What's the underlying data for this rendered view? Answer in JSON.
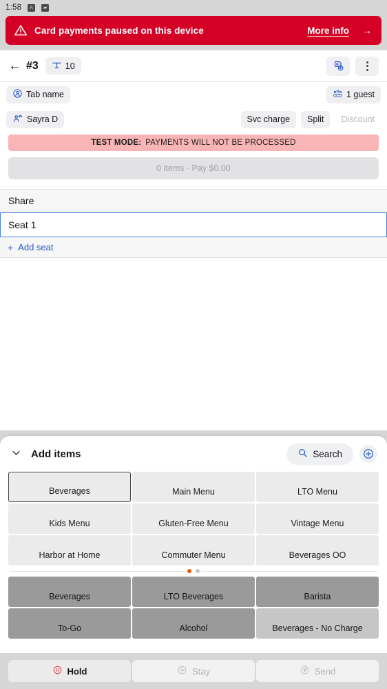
{
  "status_bar": {
    "time": "1:58",
    "icons": [
      "app-icon",
      "image-icon"
    ]
  },
  "alert": {
    "icon": "warning-triangle-icon",
    "message": "Card payments paused on this device",
    "link_label": "More info",
    "arrow": "→",
    "color": "#d50026"
  },
  "order_header": {
    "back": "←",
    "order_number": "#3",
    "table_icon": "table-icon",
    "table_number": "10",
    "refund_icon": "receipt-refund-icon",
    "more_icon": "kebab-menu-icon"
  },
  "info_row": {
    "tab_name_icon": "person-circle-icon",
    "tab_name": "Tab name",
    "guests_icon": "guests-group-icon",
    "guests": "1 guest"
  },
  "server_row": {
    "server_icon": "server-person-icon",
    "server_name": "Sayra D",
    "actions": [
      {
        "label": "Svc charge",
        "disabled": false
      },
      {
        "label": "Split",
        "disabled": false
      },
      {
        "label": "Discount",
        "disabled": true
      }
    ]
  },
  "test_mode": {
    "prefix": "TEST MODE:",
    "message": "PAYMENTS WILL NOT BE PROCESSED",
    "color": "#f9b5b5"
  },
  "pay_bar": {
    "label": "0 items · Pay $0.00",
    "disabled": true
  },
  "seats": {
    "share_label": "Share",
    "selected_seat": "Seat 1",
    "add_seat_label": "Add seat",
    "add_seat_plus": "+",
    "accent": "#2558c8"
  },
  "add_items": {
    "chevron": "chevron-down-icon",
    "title": "Add items",
    "search_icon": "search-icon",
    "search_label": "Search",
    "add_icon": "plus-circle-icon",
    "menu_tiles": [
      {
        "label": "Beverages",
        "selected": true
      },
      {
        "label": "Main Menu",
        "selected": false
      },
      {
        "label": "LTO Menu",
        "selected": false
      },
      {
        "label": "Kids Menu",
        "selected": false
      },
      {
        "label": "Gluten-Free Menu",
        "selected": false
      },
      {
        "label": "Vintage Menu",
        "selected": false
      },
      {
        "label": "Harbor at Home",
        "selected": false
      },
      {
        "label": "Commuter Menu",
        "selected": false
      },
      {
        "label": "Beverages OO",
        "selected": false
      }
    ],
    "pagination": {
      "pages": 2,
      "active_index": 0,
      "active_color": "#f0540a"
    },
    "category_tiles": [
      {
        "label": "Beverages",
        "shade": "dark"
      },
      {
        "label": "LTO Beverages",
        "shade": "dark"
      },
      {
        "label": "Barista",
        "shade": "dark"
      },
      {
        "label": "To-Go",
        "shade": "dark"
      },
      {
        "label": "Alcohol",
        "shade": "dark"
      },
      {
        "label": "Beverages - No Charge",
        "shade": "light"
      }
    ]
  },
  "footer": {
    "buttons": [
      {
        "label": "Hold",
        "icon": "pause-circle-icon",
        "disabled": false
      },
      {
        "label": "Stay",
        "icon": "stay-circle-icon",
        "disabled": true
      },
      {
        "label": "Send",
        "icon": "send-circle-icon",
        "disabled": true
      }
    ]
  }
}
